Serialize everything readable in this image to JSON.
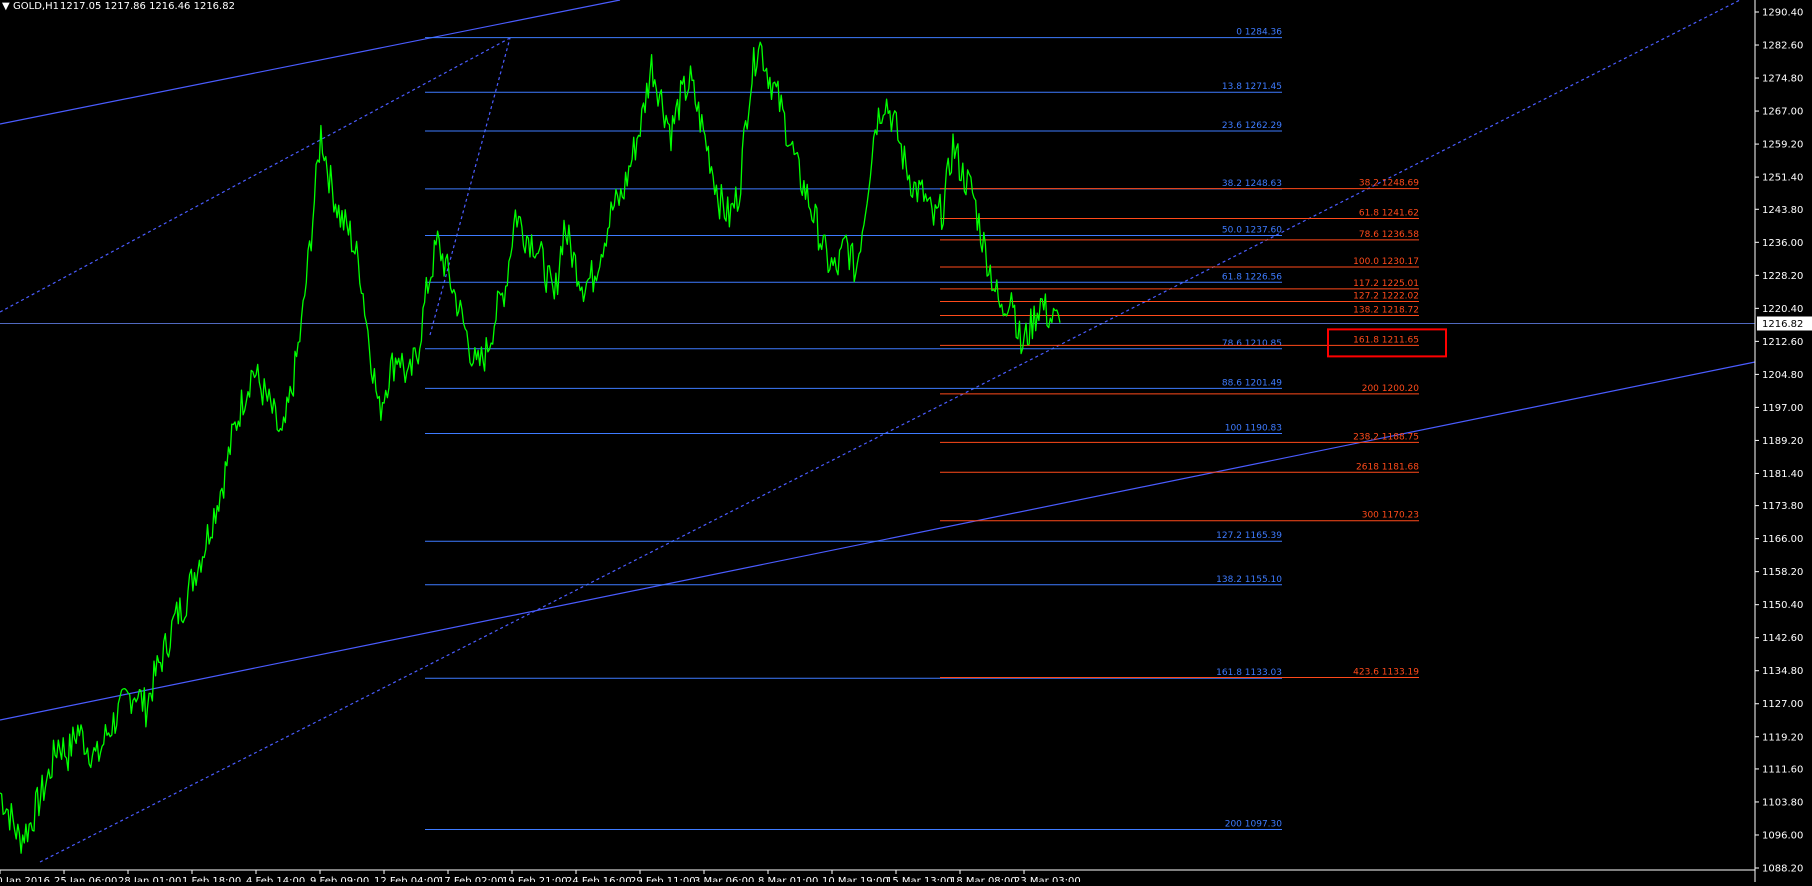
{
  "header": {
    "menu_glyph": "▼",
    "symbol": "GOLD,H1",
    "ohlc": "1217.05 1217.86 1216.46 1216.82"
  },
  "colors": {
    "background": "#000000",
    "price": "#00ff00",
    "fib_blue": "#3e7bff",
    "fib_red": "#ff4a1a",
    "trend": "#4a5cff",
    "highlight_box": "#ff0000",
    "axis_text": "#ffffff"
  },
  "chart_data": {
    "type": "line",
    "symbol": "GOLD",
    "timeframe": "H1",
    "ylim": [
      1086,
      1294
    ],
    "y_ticks": [
      1290.4,
      1282.6,
      1274.8,
      1267.0,
      1259.2,
      1251.4,
      1243.8,
      1236.0,
      1228.2,
      1220.4,
      1212.6,
      1204.8,
      1197.0,
      1189.2,
      1181.4,
      1173.8,
      1166.0,
      1158.2,
      1150.4,
      1142.6,
      1134.8,
      1127.0,
      1119.2,
      1111.6,
      1103.8,
      1096.0,
      1088.2
    ],
    "current_price": 1216.82,
    "x_labels": [
      "20 Jan 2016",
      "25 Jan 06:00",
      "28 Jan 01:00",
      "1 Feb 18:00",
      "4 Feb 14:00",
      "9 Feb 09:00",
      "12 Feb 04:00",
      "17 Feb 02:00",
      "19 Feb 21:00",
      "24 Feb 16:00",
      "29 Feb 11:00",
      "3 Mar 06:00",
      "8 Mar 01:00",
      "10 Mar 19:00",
      "15 Mar 13:00",
      "18 Mar 08:00",
      "23 Mar 03:00"
    ],
    "price_series": [
      1106,
      1101,
      1095,
      1098,
      1104,
      1110,
      1118,
      1115,
      1121,
      1117,
      1114,
      1120,
      1124,
      1128,
      1130,
      1126,
      1134,
      1140,
      1147,
      1151,
      1158,
      1164,
      1172,
      1180,
      1191,
      1199,
      1206,
      1201,
      1196,
      1189,
      1201,
      1216,
      1238,
      1262,
      1250,
      1242,
      1238,
      1230,
      1212,
      1196,
      1205,
      1210,
      1203,
      1211,
      1226,
      1236,
      1229,
      1222,
      1214,
      1206,
      1210,
      1219,
      1226,
      1243,
      1238,
      1236,
      1230,
      1222,
      1240,
      1232,
      1226,
      1228,
      1236,
      1244,
      1247,
      1256,
      1265,
      1278,
      1270,
      1262,
      1270,
      1274,
      1265,
      1256,
      1246,
      1242,
      1248,
      1271,
      1284,
      1276,
      1270,
      1262,
      1253,
      1247,
      1240,
      1232,
      1229,
      1236,
      1229,
      1245,
      1264,
      1270,
      1264,
      1255,
      1249,
      1247,
      1241,
      1244,
      1259,
      1252,
      1248,
      1237,
      1228,
      1219,
      1225,
      1211,
      1216,
      1222,
      1218,
      1217
    ],
    "fib_set_blue": [
      {
        "label": "0 1284.36",
        "price": 1284.36
      },
      {
        "label": "13.8 1271.45",
        "price": 1271.45
      },
      {
        "label": "23.6 1262.29",
        "price": 1262.29
      },
      {
        "label": "38.2 1248.63",
        "price": 1248.63
      },
      {
        "label": "50.0 1237.60",
        "price": 1237.6
      },
      {
        "label": "61.8 1226.56",
        "price": 1226.56
      },
      {
        "label": "78.6 1210.85",
        "price": 1210.85
      },
      {
        "label": "88.6 1201.49",
        "price": 1201.49
      },
      {
        "label": "100 1190.83",
        "price": 1190.83
      },
      {
        "label": "127.2 1165.39",
        "price": 1165.39
      },
      {
        "label": "138.2 1155.10",
        "price": 1155.1
      },
      {
        "label": "161.8 1133.03",
        "price": 1133.03
      },
      {
        "label": "200 1097.30",
        "price": 1097.3
      }
    ],
    "fib_set_red": [
      {
        "label": "38.2 1248.69",
        "price": 1248.69
      },
      {
        "label": "61.8 1241.62",
        "price": 1241.62
      },
      {
        "label": "78.6 1236.58",
        "price": 1236.58
      },
      {
        "label": "100.0   1230.17",
        "price": 1230.17
      },
      {
        "label": "117.2 1225.01",
        "price": 1225.01
      },
      {
        "label": "127.2 1222.02",
        "price": 1222.02
      },
      {
        "label": "138.2 1218.72",
        "price": 1218.72
      },
      {
        "label": "161.8 1211.65",
        "price": 1211.65
      },
      {
        "label": "200 1200.20",
        "price": 1200.2
      },
      {
        "label": "238.2 1188.75",
        "price": 1188.75
      },
      {
        "label": "2618 1181.68",
        "price": 1181.68
      },
      {
        "label": "300 1170.23",
        "price": 1170.23
      },
      {
        "label": "423.6 1133.19",
        "price": 1133.19
      }
    ],
    "highlighted_level": "161.8 1211.65"
  }
}
